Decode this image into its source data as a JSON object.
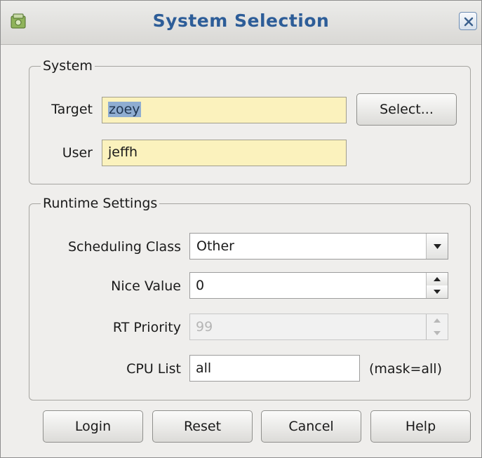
{
  "window": {
    "title": "System Selection"
  },
  "system_group": {
    "legend": "System",
    "target_label": "Target",
    "target_value": "zoey",
    "select_button": "Select...",
    "user_label": "User",
    "user_value": "jeffh"
  },
  "runtime_group": {
    "legend": "Runtime Settings",
    "scheduling_label": "Scheduling Class",
    "scheduling_value": "Other",
    "nice_label": "Nice Value",
    "nice_value": "0",
    "rt_label": "RT Priority",
    "rt_value": "99",
    "cpu_label": "CPU List",
    "cpu_value": "all",
    "cpu_mask": "(mask=all)"
  },
  "buttons": {
    "login": "Login",
    "reset": "Reset",
    "cancel": "Cancel",
    "help": "Help"
  },
  "colors": {
    "title_text": "#2d5d98",
    "field_highlight": "#fbf2bd",
    "selection": "#8fadd1"
  },
  "icons": {
    "app": "app-icon",
    "close": "close-icon",
    "dropdown": "chevron-down-icon",
    "spin_up": "spin-up-icon",
    "spin_down": "spin-down-icon"
  }
}
